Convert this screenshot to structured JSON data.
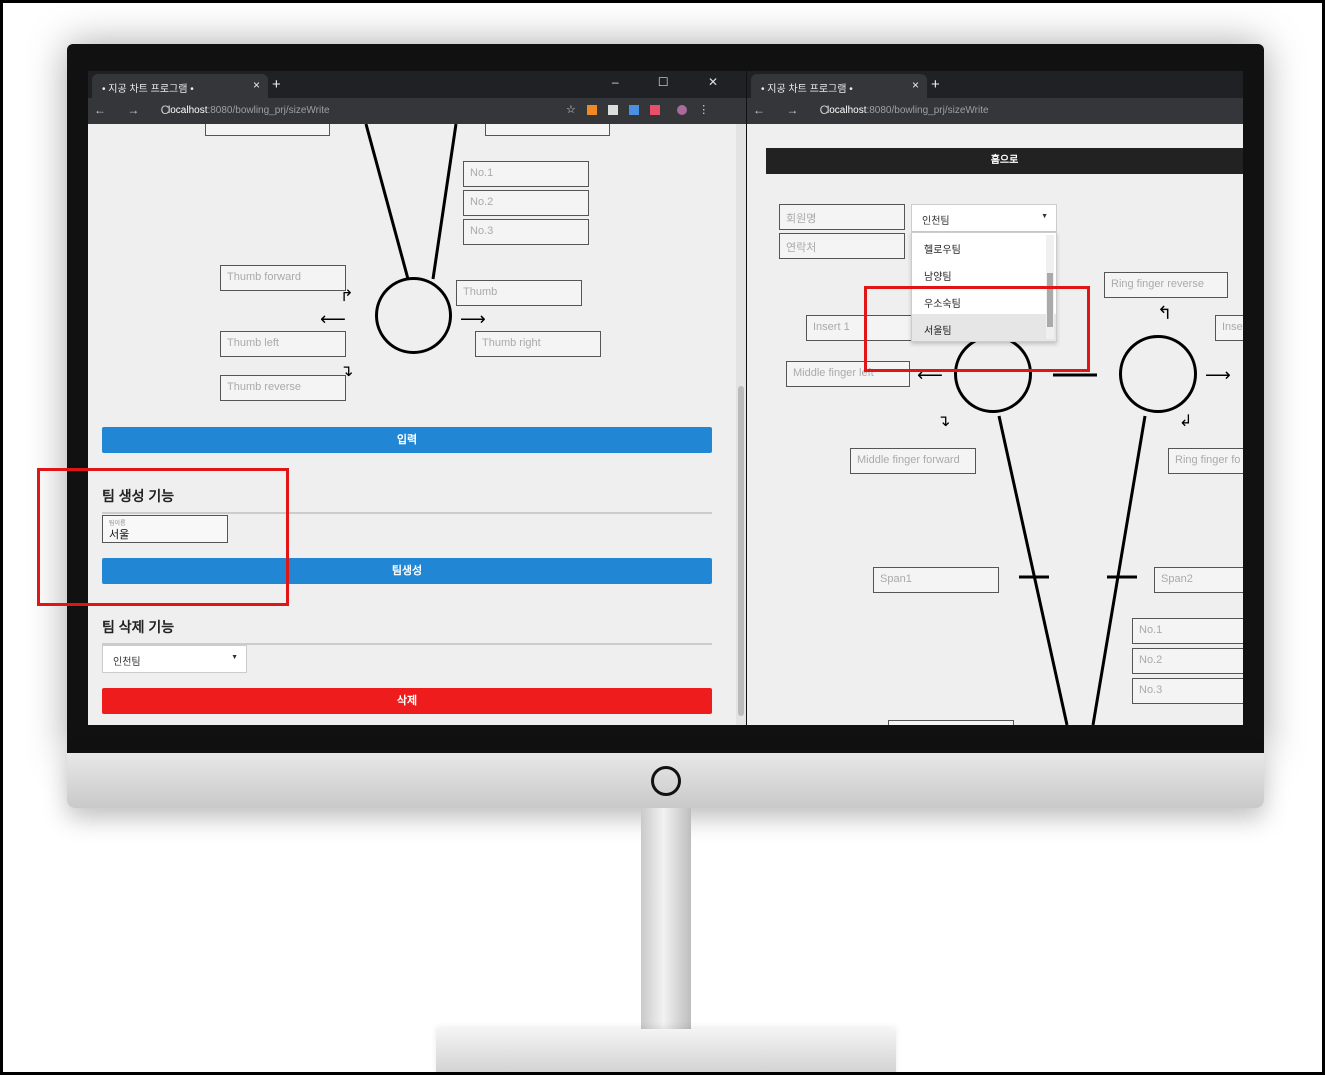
{
  "browser": {
    "tab_title": "• 지공 차트 프로그램 •",
    "tab_close": "×",
    "new_tab": "+",
    "window_controls": "–  ☐  ✕",
    "nav": "← → C",
    "url_host": "localhost",
    "url_rest": ":8080/bowling_prj/sizeWrite"
  },
  "left_page": {
    "fields": {
      "no1": "No.1",
      "no2": "No.2",
      "no3": "No.3",
      "thumb_forward": "Thumb forward",
      "thumb": "Thumb",
      "thumb_left": "Thumb left",
      "thumb_right": "Thumb right",
      "thumb_reverse": "Thumb reverse"
    },
    "submit_button": "입력",
    "team_create": {
      "title": "팀 생성 기능",
      "input_label": "팀이름",
      "input_value": "서울",
      "button": "팀생성"
    },
    "team_delete": {
      "title": "팀 삭제 기능",
      "selected": "인천팀",
      "button": "삭제"
    }
  },
  "right_page": {
    "home_button": "홈으로",
    "member_name_placeholder": "회원명",
    "contact_placeholder": "연락처",
    "team_select": {
      "selected": "인천팀",
      "options": [
        "헬로우팀",
        "남양팀",
        "우소숙팀",
        "서울팀"
      ],
      "highlighted": "서울팀"
    },
    "fields": {
      "ring_finger_reverse": "Ring finger reverse",
      "insert1": "Insert 1",
      "insert_cut": "Inse",
      "middle_finger_left": "Middle finger left",
      "middle_finger_forward": "Middle finger forward",
      "ring_finger_forward": "Ring finger fo",
      "span1": "Span1",
      "span2": "Span2",
      "no1": "No.1",
      "no2": "No.2",
      "no3": "No.3"
    }
  },
  "colors": {
    "accent_blue": "#2187d4",
    "danger_red": "#ee1c1c",
    "highlight_red": "#e01515"
  }
}
